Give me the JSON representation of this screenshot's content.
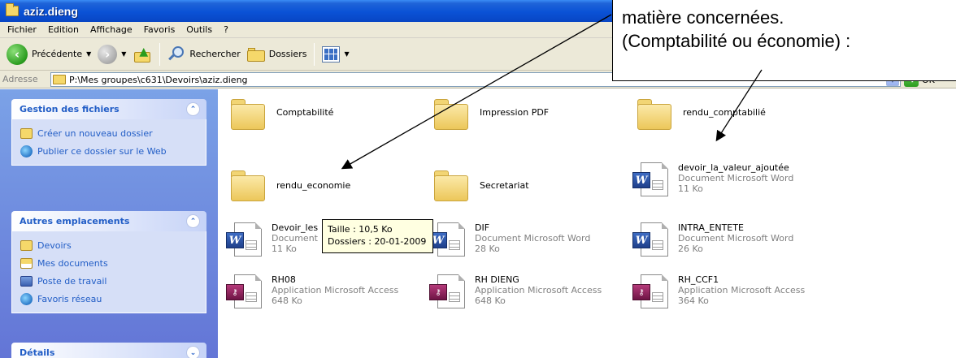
{
  "window": {
    "title": "aziz.dieng"
  },
  "menu": [
    "Fichier",
    "Edition",
    "Affichage",
    "Favoris",
    "Outils",
    "?"
  ],
  "toolbar": {
    "back_label": "Précédente",
    "search_label": "Rechercher",
    "folders_label": "Dossiers"
  },
  "address": {
    "label": "Adresse",
    "value": "P:\\Mes groupes\\c631\\Devoirs\\aziz.dieng",
    "go_label": "OK"
  },
  "sidebar": {
    "tasks": {
      "title": "Gestion des fichiers",
      "items": [
        "Créer un nouveau dossier",
        "Publier ce dossier sur le Web"
      ]
    },
    "places": {
      "title": "Autres emplacements",
      "items": [
        "Devoirs",
        "Mes documents",
        "Poste de travail",
        "Favoris réseau"
      ]
    },
    "details": {
      "title": "Détails"
    }
  },
  "files": [
    {
      "name": "Comptabilité",
      "type": "folder"
    },
    {
      "name": "Impression PDF",
      "type": "folder"
    },
    {
      "name": "rendu_comptabilié",
      "type": "folder"
    },
    {
      "name": "rendu_economie",
      "type": "folder"
    },
    {
      "name": "Secretariat",
      "type": "folder"
    },
    {
      "name": "devoir_la_valeur_ajoutée",
      "type": "word",
      "kind": "Document Microsoft Word",
      "size": "11 Ko"
    },
    {
      "name": "Devoir_les",
      "type": "word",
      "kind": "Document",
      "size": "11 Ko"
    },
    {
      "name": "DIF",
      "type": "word",
      "kind": "Document Microsoft Word",
      "size": "28 Ko"
    },
    {
      "name": "INTRA_ENTETE",
      "type": "word",
      "kind": "Document Microsoft Word",
      "size": "26 Ko"
    },
    {
      "name": "RH08",
      "type": "access",
      "kind": "Application Microsoft Access",
      "size": "648 Ko"
    },
    {
      "name": "RH DIENG",
      "type": "access",
      "kind": "Application Microsoft Access",
      "size": "648 Ko"
    },
    {
      "name": "RH_CCF1",
      "type": "access",
      "kind": "Application Microsoft Access",
      "size": "364 Ko"
    }
  ],
  "tooltip": {
    "line1": "Taille : 10,5 Ko",
    "line2": "Dossiers : 20-01-2009"
  },
  "callout": {
    "line1": "matière concernées.",
    "line2": "(Comptabilité ou économie) :"
  }
}
